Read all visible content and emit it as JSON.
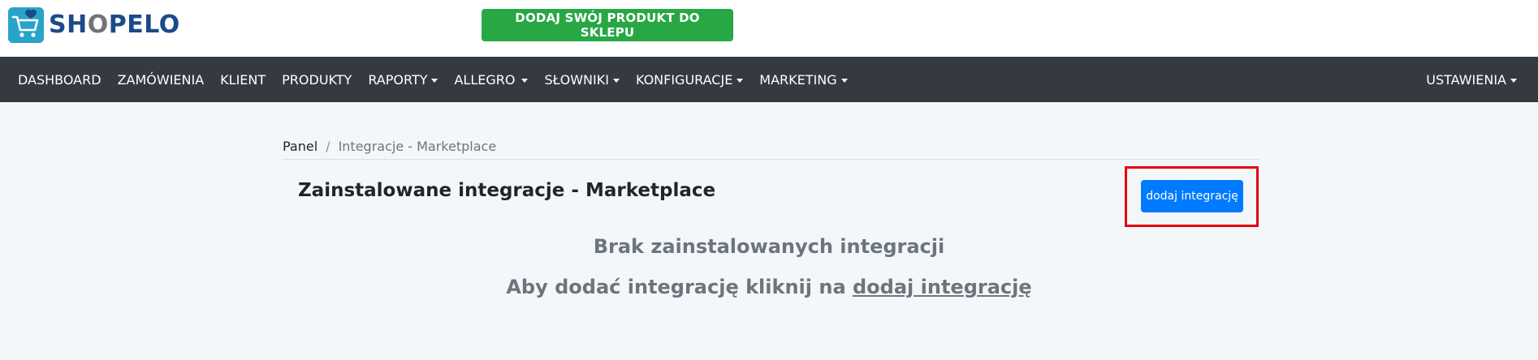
{
  "header": {
    "logo_text_1": "SH",
    "logo_text_o": "O",
    "logo_text_2": "PELO",
    "cta_label": "DODAJ SWÓJ PRODUKT DO SKLEPU"
  },
  "nav": {
    "items": [
      {
        "label": "DASHBOARD",
        "dropdown": false
      },
      {
        "label": "ZAMÓWIENIA",
        "dropdown": false
      },
      {
        "label": "KLIENT",
        "dropdown": false
      },
      {
        "label": "PRODUKTY",
        "dropdown": false
      },
      {
        "label": "RAPORTY",
        "dropdown": true
      },
      {
        "label": "ALLEGRO",
        "dropdown": true
      },
      {
        "label": "SŁOWNIKI",
        "dropdown": true
      },
      {
        "label": "KONFIGURACJE",
        "dropdown": true
      },
      {
        "label": "MARKETING",
        "dropdown": true
      }
    ],
    "right_label": "USTAWIENIA"
  },
  "breadcrumb": {
    "home": "Panel",
    "separator": "/",
    "current": "Integracje - Marketplace"
  },
  "main": {
    "title": "Zainstalowane integracje - Marketplace",
    "add_button_label": "dodaj integrację",
    "empty_title": "Brak zainstalowanych integracji",
    "empty_hint_prefix": "Aby dodać integrację kliknij na ",
    "empty_hint_link": "dodaj integrację"
  },
  "colors": {
    "brand_blue": "#1b4a8c",
    "cta_green": "#28a745",
    "nav_bg": "#343a40",
    "primary_button": "#007bff",
    "highlight_red": "#e3000f",
    "page_bg": "#f4f7fa"
  },
  "icons": {
    "logo": "shopping-cart-heart-icon",
    "dropdown": "caret-down-icon"
  }
}
